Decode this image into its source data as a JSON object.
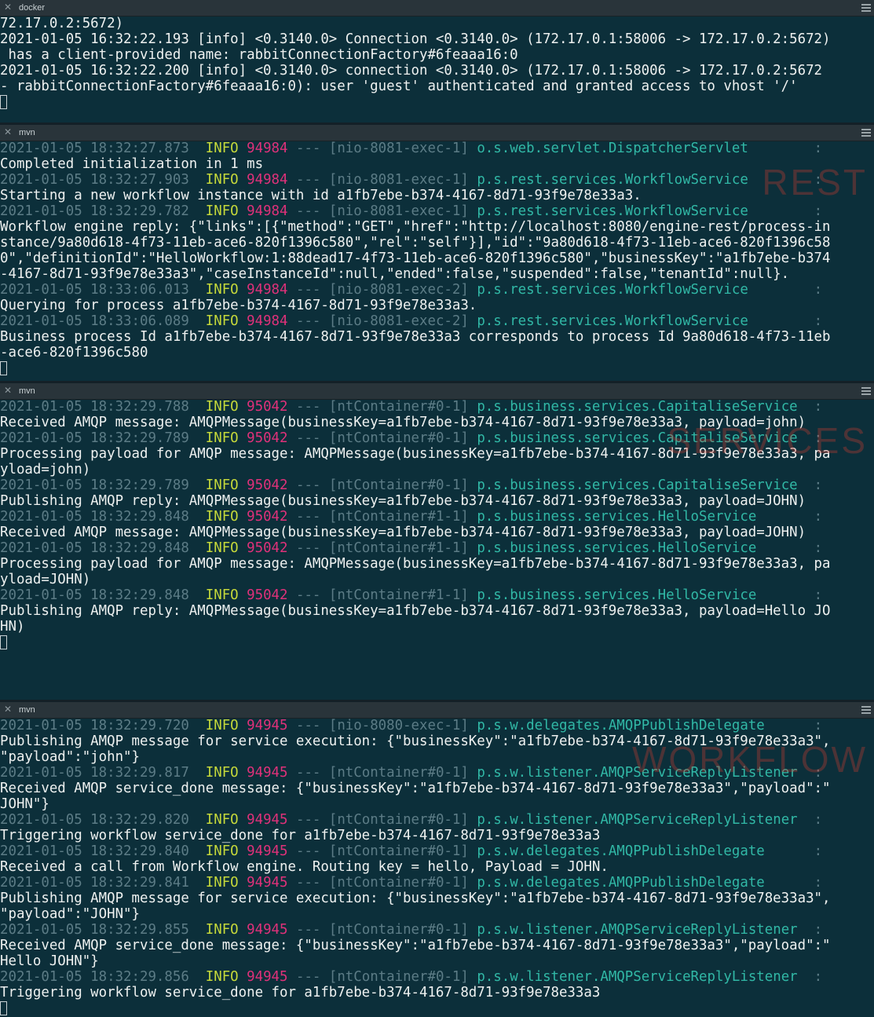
{
  "panes": [
    {
      "tab": "docker",
      "watermark": "",
      "lines": [
        [
          [
            "t",
            "72.17.0.2:5672)"
          ]
        ],
        [
          [
            "t",
            "2021-01-05 16:32:22.193 [info] <0.3140.0> Connection <0.3140.0> (172.17.0.1:58006 -> 172.17.0.2:5672)"
          ]
        ],
        [
          [
            "t",
            " has a client-provided name: rabbitConnectionFactory#6feaaa16:0"
          ]
        ],
        [
          [
            "t",
            "2021-01-05 16:32:22.200 [info] <0.3140.0> connection <0.3140.0> (172.17.0.1:58006 -> 172.17.0.2:5672"
          ]
        ],
        [
          [
            "t",
            "- rabbitConnectionFactory#6feaaa16:0): user 'guest' authenticated and granted access to vhost '/'"
          ]
        ]
      ]
    },
    {
      "tab": "mvn",
      "watermark": "REST",
      "lines": [
        [
          [
            "d",
            "2021-01-05 18:32:27.873  "
          ],
          [
            "i",
            "INFO"
          ],
          [
            "t",
            " "
          ],
          [
            "p",
            "94984"
          ],
          [
            "d",
            " --- [nio-8081-exec-1] "
          ],
          [
            "l",
            "o.s.web.servlet.DispatcherServlet"
          ],
          [
            "d",
            "        :"
          ]
        ],
        [
          [
            "t",
            "Completed initialization in 1 ms"
          ]
        ],
        [
          [
            "d",
            "2021-01-05 18:32:27.903  "
          ],
          [
            "i",
            "INFO"
          ],
          [
            "t",
            " "
          ],
          [
            "p",
            "94984"
          ],
          [
            "d",
            " --- [nio-8081-exec-1] "
          ],
          [
            "l",
            "p.s.rest.services.WorkflowService"
          ],
          [
            "d",
            "        :"
          ]
        ],
        [
          [
            "t",
            "Starting a new workflow instance with id a1fb7ebe-b374-4167-8d71-93f9e78e33a3."
          ]
        ],
        [
          [
            "d",
            "2021-01-05 18:32:29.782  "
          ],
          [
            "i",
            "INFO"
          ],
          [
            "t",
            " "
          ],
          [
            "p",
            "94984"
          ],
          [
            "d",
            " --- [nio-8081-exec-1] "
          ],
          [
            "l",
            "p.s.rest.services.WorkflowService"
          ],
          [
            "d",
            "        :"
          ]
        ],
        [
          [
            "t",
            "Workflow engine reply: {\"links\":[{\"method\":\"GET\",\"href\":\"http://localhost:8080/engine-rest/process-in"
          ]
        ],
        [
          [
            "t",
            "stance/9a80d618-4f73-11eb-ace6-820f1396c580\",\"rel\":\"self\"}],\"id\":\"9a80d618-4f73-11eb-ace6-820f1396c58"
          ]
        ],
        [
          [
            "t",
            "0\",\"definitionId\":\"HelloWorkflow:1:88dead17-4f73-11eb-ace6-820f1396c580\",\"businessKey\":\"a1fb7ebe-b374"
          ]
        ],
        [
          [
            "t",
            "-4167-8d71-93f9e78e33a3\",\"caseInstanceId\":null,\"ended\":false,\"suspended\":false,\"tenantId\":null}."
          ]
        ],
        [
          [
            "d",
            "2021-01-05 18:33:06.013  "
          ],
          [
            "i",
            "INFO"
          ],
          [
            "t",
            " "
          ],
          [
            "p",
            "94984"
          ],
          [
            "d",
            " --- [nio-8081-exec-2] "
          ],
          [
            "l",
            "p.s.rest.services.WorkflowService"
          ],
          [
            "d",
            "        :"
          ]
        ],
        [
          [
            "t",
            "Querying for process a1fb7ebe-b374-4167-8d71-93f9e78e33a3."
          ]
        ],
        [
          [
            "d",
            "2021-01-05 18:33:06.089  "
          ],
          [
            "i",
            "INFO"
          ],
          [
            "t",
            " "
          ],
          [
            "p",
            "94984"
          ],
          [
            "d",
            " --- [nio-8081-exec-2] "
          ],
          [
            "l",
            "p.s.rest.services.WorkflowService"
          ],
          [
            "d",
            "        :"
          ]
        ],
        [
          [
            "t",
            "Business process Id a1fb7ebe-b374-4167-8d71-93f9e78e33a3 corresponds to process Id 9a80d618-4f73-11eb"
          ]
        ],
        [
          [
            "t",
            "-ace6-820f1396c580"
          ]
        ]
      ]
    },
    {
      "tab": "mvn",
      "watermark": "SERVICES",
      "lines": [
        [
          [
            "d",
            "2021-01-05 18:32:29.788  "
          ],
          [
            "i",
            "INFO"
          ],
          [
            "t",
            " "
          ],
          [
            "p",
            "95042"
          ],
          [
            "d",
            " --- [ntContainer#0-1] "
          ],
          [
            "l",
            "p.s.business.services.CapitaliseService"
          ],
          [
            "d",
            "  :"
          ]
        ],
        [
          [
            "t",
            "Received AMQP message: AMQPMessage(businessKey=a1fb7ebe-b374-4167-8d71-93f9e78e33a3, payload=john)"
          ]
        ],
        [
          [
            "d",
            "2021-01-05 18:32:29.789  "
          ],
          [
            "i",
            "INFO"
          ],
          [
            "t",
            " "
          ],
          [
            "p",
            "95042"
          ],
          [
            "d",
            " --- [ntContainer#0-1] "
          ],
          [
            "l",
            "p.s.business.services.CapitaliseService"
          ],
          [
            "d",
            "  :"
          ]
        ],
        [
          [
            "t",
            "Processing payload for AMQP message: AMQPMessage(businessKey=a1fb7ebe-b374-4167-8d71-93f9e78e33a3, pa"
          ]
        ],
        [
          [
            "t",
            "yload=john)"
          ]
        ],
        [
          [
            "d",
            "2021-01-05 18:32:29.789  "
          ],
          [
            "i",
            "INFO"
          ],
          [
            "t",
            " "
          ],
          [
            "p",
            "95042"
          ],
          [
            "d",
            " --- [ntContainer#0-1] "
          ],
          [
            "l",
            "p.s.business.services.CapitaliseService"
          ],
          [
            "d",
            "  :"
          ]
        ],
        [
          [
            "t",
            "Publishing AMQP reply: AMQPMessage(businessKey=a1fb7ebe-b374-4167-8d71-93f9e78e33a3, payload=JOHN)"
          ]
        ],
        [
          [
            "d",
            "2021-01-05 18:32:29.848  "
          ],
          [
            "i",
            "INFO"
          ],
          [
            "t",
            " "
          ],
          [
            "p",
            "95042"
          ],
          [
            "d",
            " --- [ntContainer#1-1] "
          ],
          [
            "l",
            "p.s.business.services.HelloService"
          ],
          [
            "d",
            "       :"
          ]
        ],
        [
          [
            "t",
            "Received AMQP message: AMQPMessage(businessKey=a1fb7ebe-b374-4167-8d71-93f9e78e33a3, payload=JOHN)"
          ]
        ],
        [
          [
            "d",
            "2021-01-05 18:32:29.848  "
          ],
          [
            "i",
            "INFO"
          ],
          [
            "t",
            " "
          ],
          [
            "p",
            "95042"
          ],
          [
            "d",
            " --- [ntContainer#1-1] "
          ],
          [
            "l",
            "p.s.business.services.HelloService"
          ],
          [
            "d",
            "       :"
          ]
        ],
        [
          [
            "t",
            "Processing payload for AMQP message: AMQPMessage(businessKey=a1fb7ebe-b374-4167-8d71-93f9e78e33a3, pa"
          ]
        ],
        [
          [
            "t",
            "yload=JOHN)"
          ]
        ],
        [
          [
            "d",
            "2021-01-05 18:32:29.848  "
          ],
          [
            "i",
            "INFO"
          ],
          [
            "t",
            " "
          ],
          [
            "p",
            "95042"
          ],
          [
            "d",
            " --- [ntContainer#1-1] "
          ],
          [
            "l",
            "p.s.business.services.HelloService"
          ],
          [
            "d",
            "       :"
          ]
        ],
        [
          [
            "t",
            "Publishing AMQP reply: AMQPMessage(businessKey=a1fb7ebe-b374-4167-8d71-93f9e78e33a3, payload=Hello JO"
          ]
        ],
        [
          [
            "t",
            "HN)"
          ]
        ]
      ]
    },
    {
      "tab": "mvn",
      "watermark": "WORKFLOW",
      "lines": [
        [
          [
            "d",
            "2021-01-05 18:32:29.720  "
          ],
          [
            "i",
            "INFO"
          ],
          [
            "t",
            " "
          ],
          [
            "p",
            "94945"
          ],
          [
            "d",
            " --- [nio-8080-exec-1] "
          ],
          [
            "l",
            "p.s.w.delegates.AMQPPublishDelegate"
          ],
          [
            "d",
            "      :"
          ]
        ],
        [
          [
            "t",
            "Publishing AMQP message for service execution: {\"businessKey\":\"a1fb7ebe-b374-4167-8d71-93f9e78e33a3\","
          ]
        ],
        [
          [
            "t",
            "\"payload\":\"john\"}"
          ]
        ],
        [
          [
            "d",
            "2021-01-05 18:32:29.817  "
          ],
          [
            "i",
            "INFO"
          ],
          [
            "t",
            " "
          ],
          [
            "p",
            "94945"
          ],
          [
            "d",
            " --- [ntContainer#0-1] "
          ],
          [
            "l",
            "p.s.w.listener.AMQPServiceReplyListener"
          ],
          [
            "d",
            "  :"
          ]
        ],
        [
          [
            "t",
            "Received AMQP service_done message: {\"businessKey\":\"a1fb7ebe-b374-4167-8d71-93f9e78e33a3\",\"payload\":\""
          ]
        ],
        [
          [
            "t",
            "JOHN\"}"
          ]
        ],
        [
          [
            "d",
            "2021-01-05 18:32:29.820  "
          ],
          [
            "i",
            "INFO"
          ],
          [
            "t",
            " "
          ],
          [
            "p",
            "94945"
          ],
          [
            "d",
            " --- [ntContainer#0-1] "
          ],
          [
            "l",
            "p.s.w.listener.AMQPServiceReplyListener"
          ],
          [
            "d",
            "  :"
          ]
        ],
        [
          [
            "t",
            "Triggering workflow service_done for a1fb7ebe-b374-4167-8d71-93f9e78e33a3"
          ]
        ],
        [
          [
            "d",
            "2021-01-05 18:32:29.840  "
          ],
          [
            "i",
            "INFO"
          ],
          [
            "t",
            " "
          ],
          [
            "p",
            "94945"
          ],
          [
            "d",
            " --- [ntContainer#0-1] "
          ],
          [
            "l",
            "p.s.w.delegates.AMQPPublishDelegate"
          ],
          [
            "d",
            "      :"
          ]
        ],
        [
          [
            "t",
            "Received a call from Workflow engine. Routing key = hello, Payload = JOHN."
          ]
        ],
        [
          [
            "d",
            "2021-01-05 18:32:29.841  "
          ],
          [
            "i",
            "INFO"
          ],
          [
            "t",
            " "
          ],
          [
            "p",
            "94945"
          ],
          [
            "d",
            " --- [ntContainer#0-1] "
          ],
          [
            "l",
            "p.s.w.delegates.AMQPPublishDelegate"
          ],
          [
            "d",
            "      :"
          ]
        ],
        [
          [
            "t",
            "Publishing AMQP message for service execution: {\"businessKey\":\"a1fb7ebe-b374-4167-8d71-93f9e78e33a3\","
          ]
        ],
        [
          [
            "t",
            "\"payload\":\"JOHN\"}"
          ]
        ],
        [
          [
            "d",
            "2021-01-05 18:32:29.855  "
          ],
          [
            "i",
            "INFO"
          ],
          [
            "t",
            " "
          ],
          [
            "p",
            "94945"
          ],
          [
            "d",
            " --- [ntContainer#0-1] "
          ],
          [
            "l",
            "p.s.w.listener.AMQPServiceReplyListener"
          ],
          [
            "d",
            "  :"
          ]
        ],
        [
          [
            "t",
            "Received AMQP service_done message: {\"businessKey\":\"a1fb7ebe-b374-4167-8d71-93f9e78e33a3\",\"payload\":\""
          ]
        ],
        [
          [
            "t",
            "Hello JOHN\"}"
          ]
        ],
        [
          [
            "d",
            "2021-01-05 18:32:29.856  "
          ],
          [
            "i",
            "INFO"
          ],
          [
            "t",
            " "
          ],
          [
            "p",
            "94945"
          ],
          [
            "d",
            " --- [ntContainer#0-1] "
          ],
          [
            "l",
            "p.s.w.listener.AMQPServiceReplyListener"
          ],
          [
            "d",
            "  :"
          ]
        ],
        [
          [
            "t",
            "Triggering workflow service_done for a1fb7ebe-b374-4167-8d71-93f9e78e33a3"
          ]
        ]
      ]
    }
  ],
  "colors": {
    "background": "#0c2f3a",
    "text": "#eef1f0",
    "dim": "#5c7c86",
    "info": "#c6d93a",
    "pid": "#e0317a",
    "logger": "#31b8a6"
  }
}
